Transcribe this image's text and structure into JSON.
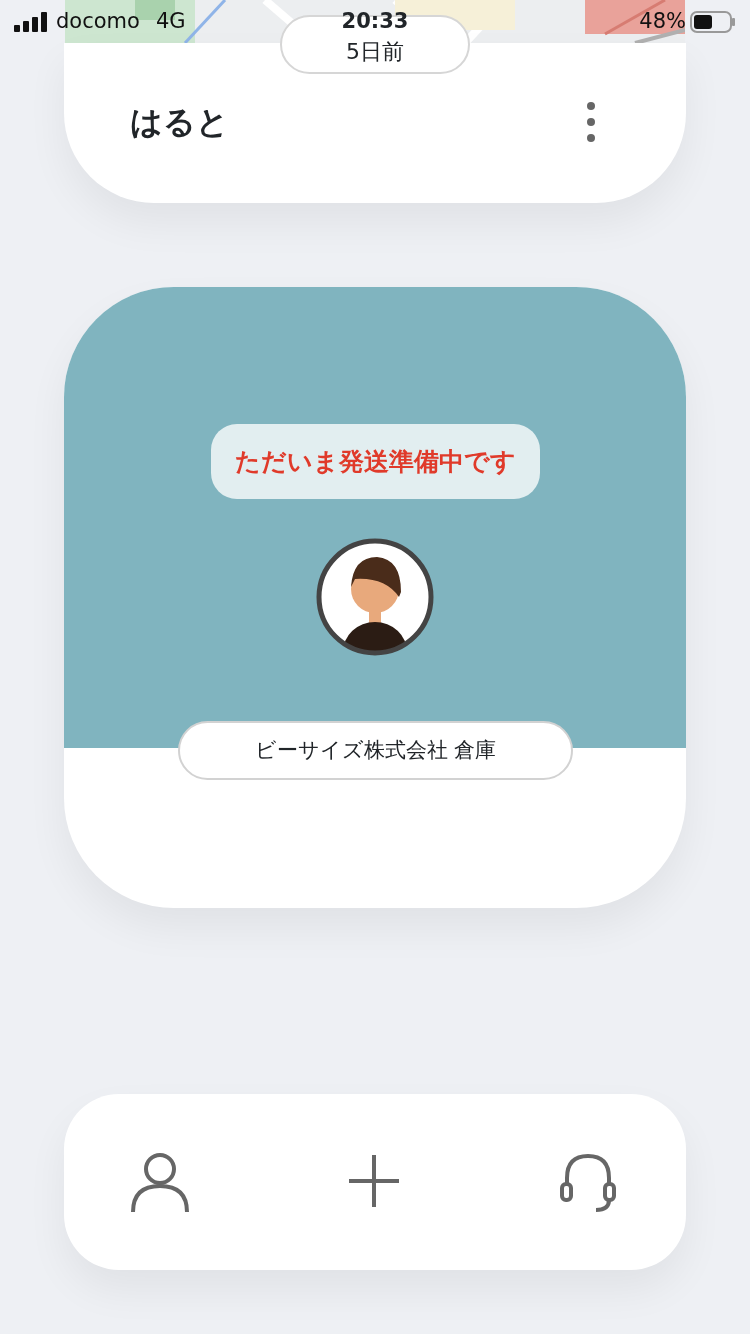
{
  "status_bar": {
    "carrier": "docomo",
    "network": "4G",
    "time": "20:33",
    "battery": "48%"
  },
  "top_card": {
    "time_ago": "5日前",
    "name": "はると"
  },
  "shipment": {
    "status": "ただいま発送準備中です",
    "location": "ビーサイズ株式会社 倉庫"
  },
  "bottom_nav": [
    {
      "kind": "person"
    },
    {
      "kind": "add"
    },
    {
      "kind": "headset"
    }
  ]
}
